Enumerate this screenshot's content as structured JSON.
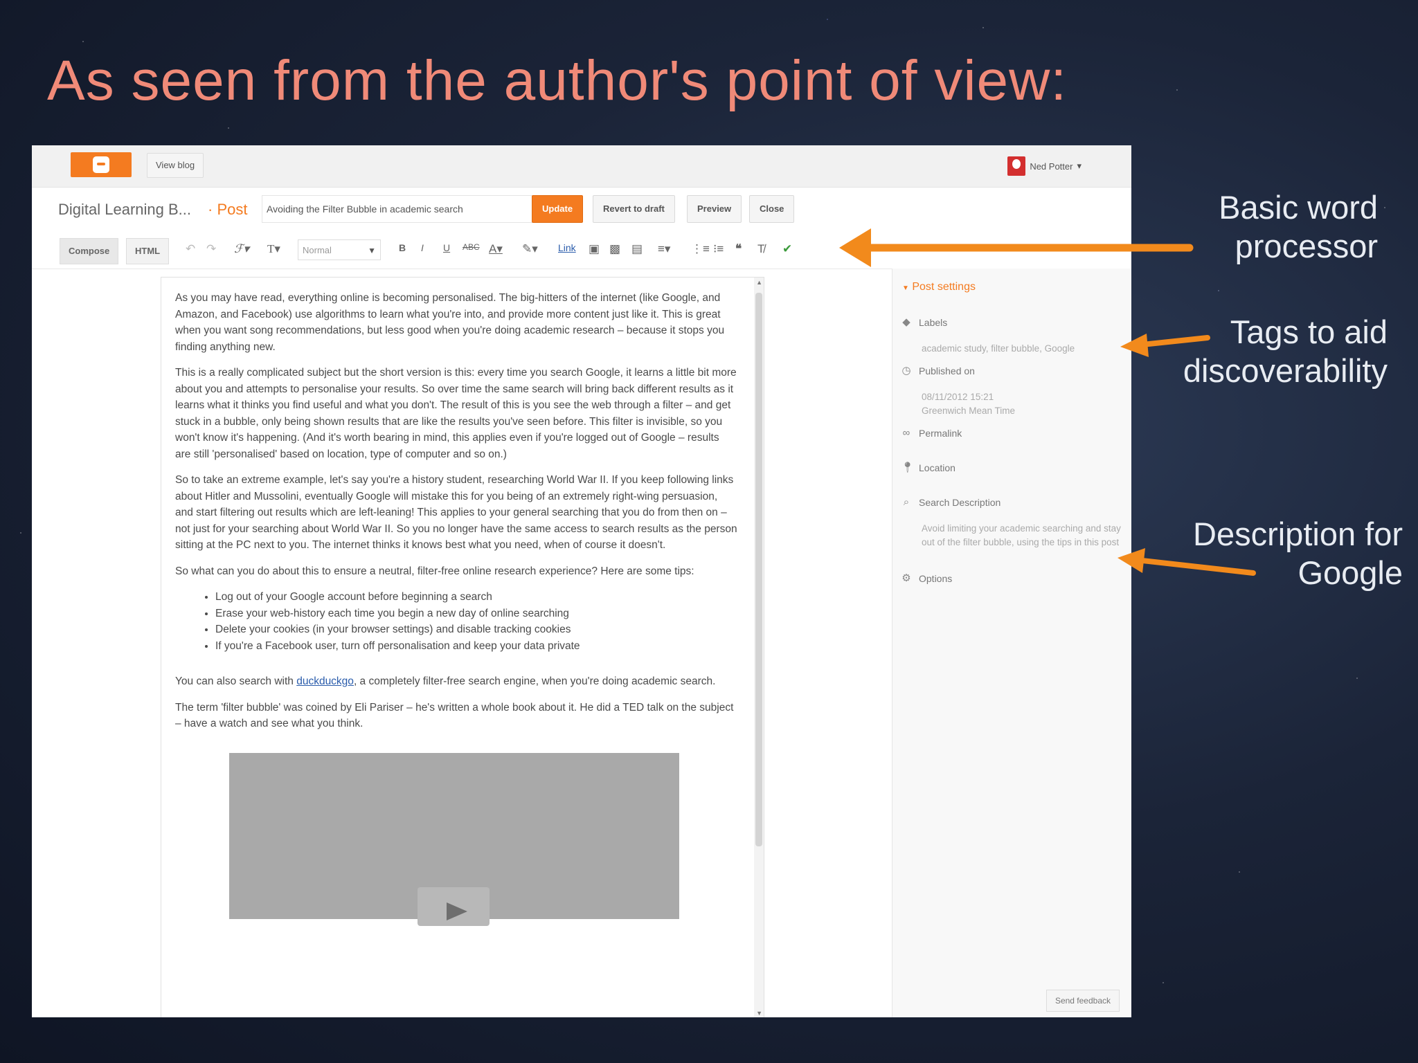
{
  "slide": {
    "title": "As seen from the author's point of view:"
  },
  "annotations": {
    "word_processor": [
      "Basic word",
      "processor"
    ],
    "tags": [
      "Tags to aid",
      "discoverability"
    ],
    "description": [
      "Description for",
      "Google"
    ]
  },
  "colors": {
    "accent": "#f47b20",
    "title": "#f08a78",
    "arrow": "#f28a1c"
  },
  "topbar": {
    "view_blog": "View blog",
    "user_name": "Ned Potter"
  },
  "postbar": {
    "blog_name": "Digital Learning B...",
    "separator": "· Post",
    "post_title": "Avoiding the Filter Bubble in academic search",
    "update": "Update",
    "revert": "Revert to draft",
    "preview": "Preview",
    "close": "Close"
  },
  "toolbar": {
    "compose": "Compose",
    "html": "HTML",
    "format_select": "Normal",
    "link": "Link",
    "icons": [
      "undo-icon",
      "redo-icon",
      "font-icon",
      "font-size-icon",
      "bold-icon",
      "italic-icon",
      "underline-icon",
      "strikethrough-icon",
      "text-color-icon",
      "highlight-icon",
      "link-icon",
      "image-icon",
      "video-icon",
      "jump-break-icon",
      "align-icon",
      "numbered-list-icon",
      "bulleted-list-icon",
      "quote-icon",
      "clear-format-icon",
      "spellcheck-icon"
    ]
  },
  "editor": {
    "p1": "As you may have read, everything online is becoming personalised. The big-hitters of the internet (like Google, and Amazon, and Facebook) use algorithms to learn what you're into, and provide more content just like it. This is great when you want song recommendations, but less good when you're doing academic research – because it stops you finding anything new.",
    "p2": "This is a really complicated subject but the short version is this: every time you search Google, it learns a little bit more about you and attempts to personalise your results. So over time the same search will bring back different results as it learns what it thinks you find useful and what you don't. The result of this is you see the web through a filter – and get stuck in a bubble, only being shown results that are like the results you've seen before. This filter is invisible, so you won't know it's happening. (And it's worth bearing in mind, this applies even if you're logged out of Google – results are still 'personalised' based on location, type of computer and so on.)",
    "p3": "So to take an extreme example, let's say you're a history student, researching World War II. If you keep following links about Hitler and Mussolini, eventually Google will mistake this for you being of an extremely right-wing persuasion, and start filtering out results which are left-leaning! This applies to your general searching that you do from then on – not just for your searching about World War II. So you no longer have the same access to search results as the person sitting at the PC next to you. The internet thinks it knows best what you need, when of course it doesn't.",
    "p4": "So what can you do about this to ensure a neutral, filter-free online research experience? Here are some tips:",
    "tips": [
      "Log out of your Google account before beginning a search",
      "Erase your web-history each time you begin a new day of online searching",
      "Delete your cookies (in your browser settings) and disable tracking cookies",
      "If you're a Facebook user, turn off personalisation and keep your data private"
    ],
    "p5_before": "You can also search with ",
    "p5_link": "duckduckgo",
    "p5_after": ", a completely filter-free search engine, when you're doing academic search.",
    "p6": "The term 'filter bubble' was coined by Eli Pariser – he's written a whole book about it. He did a TED talk on the subject – have a watch and see what you think."
  },
  "sidebar": {
    "header": "Post settings",
    "labels_title": "Labels",
    "labels_value": "academic study, filter bubble, Google",
    "published_title": "Published on",
    "published_date": "08/11/2012 15:21",
    "published_tz": "Greenwich Mean Time",
    "permalink": "Permalink",
    "location": "Location",
    "search_desc_title": "Search Description",
    "search_desc_value": "Avoid limiting your academic searching and stay out of the filter bubble, using the tips in this post",
    "options": "Options",
    "feedback": "Send feedback"
  }
}
